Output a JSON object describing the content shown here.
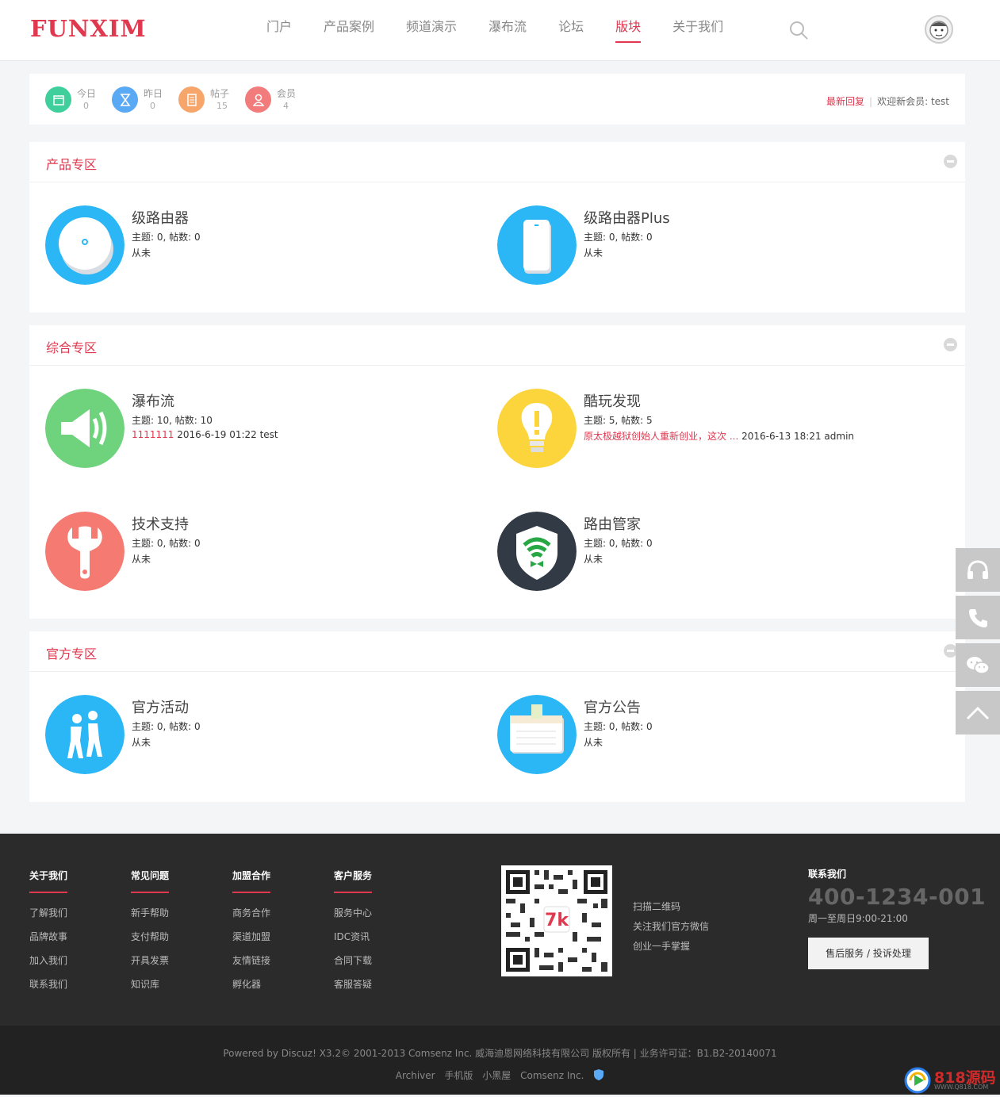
{
  "header": {
    "logo": "FUNXIM",
    "nav": [
      "门户",
      "产品案例",
      "频道演示",
      "瀑布流",
      "论坛",
      "版块",
      "关于我们"
    ],
    "active_nav": "版块"
  },
  "stats": {
    "items": [
      {
        "label": "今日",
        "value": "0",
        "color": "#3fcf9d"
      },
      {
        "label": "昨日",
        "value": "0",
        "color": "#5aa9f4"
      },
      {
        "label": "帖子",
        "value": "15",
        "color": "#f6a56b"
      },
      {
        "label": "会员",
        "value": "4",
        "color": "#f27b7b"
      }
    ],
    "latest_reply": "最新回复",
    "welcome_prefix": "欢迎新会员:",
    "welcome_user": "test"
  },
  "sections": [
    {
      "title": "产品专区",
      "forums": [
        {
          "name": "级路由器",
          "stats": "主题: 0, 帖数: 0",
          "last": "从未",
          "icon": "router-round-icon"
        },
        {
          "name": "级路由器Plus",
          "stats": "主题: 0, 帖数: 0",
          "last": "从未",
          "icon": "router-tall-icon"
        }
      ]
    },
    {
      "title": "综合专区",
      "forums": [
        {
          "name": "瀑布流",
          "stats": "主题: 10, 帖数: 10",
          "last_link": "1111111",
          "last": "2016-6-19 01:22 test",
          "icon": "speaker-icon"
        },
        {
          "name": "酷玩发现",
          "stats": "主题: 5, 帖数: 5",
          "last_link": "原太极越狱创始人重新创业，这次 ...",
          "last": "2016-6-13 18:21 admin",
          "icon": "lightbulb-icon"
        },
        {
          "name": "技术支持",
          "stats": "主题: 0, 帖数: 0",
          "last": "从未",
          "icon": "wrench-icon"
        },
        {
          "name": "路由管家",
          "stats": "主题: 0, 帖数: 0",
          "last": "从未",
          "icon": "wifi-shield-icon"
        }
      ]
    },
    {
      "title": "官方专区",
      "forums": [
        {
          "name": "官方活动",
          "stats": "主题: 0, 帖数: 0",
          "last": "从未",
          "icon": "people-icon"
        },
        {
          "name": "官方公告",
          "stats": "主题: 0, 帖数: 0",
          "last": "从未",
          "icon": "notice-board-icon"
        }
      ]
    }
  ],
  "footer": {
    "columns": [
      {
        "title": "关于我们",
        "items": [
          "了解我们",
          "品牌故事",
          "加入我们",
          "联系我们"
        ]
      },
      {
        "title": "常见问题",
        "items": [
          "新手帮助",
          "支付帮助",
          "开具发票",
          "知识库"
        ]
      },
      {
        "title": "加盟合作",
        "items": [
          "商务合作",
          "渠道加盟",
          "友情链接",
          "孵化器"
        ]
      },
      {
        "title": "客户服务",
        "items": [
          "服务中心",
          "IDC资讯",
          "合同下载",
          "客服答疑"
        ]
      }
    ],
    "qr_lines": [
      "扫描二维码",
      "关注我们官方微信",
      "创业一手掌握"
    ],
    "contact_title": "联系我们",
    "phone": "400-1234-001",
    "hours": "周一至周日9:00-21:00",
    "service_button": "售后服务 / 投诉处理"
  },
  "copyright": {
    "line1": "Powered by Discuz! X3.2© 2001-2013 Comsenz Inc.  威海迪恩网络科技有限公司 版权所有    | 业务许可证：B1.B2-20140071",
    "links": [
      "Archiver",
      "手机版",
      "小黑屋",
      "Comsenz Inc."
    ]
  },
  "watermark": {
    "text": "818源码",
    "sub": "WWW.Q818.COM"
  }
}
